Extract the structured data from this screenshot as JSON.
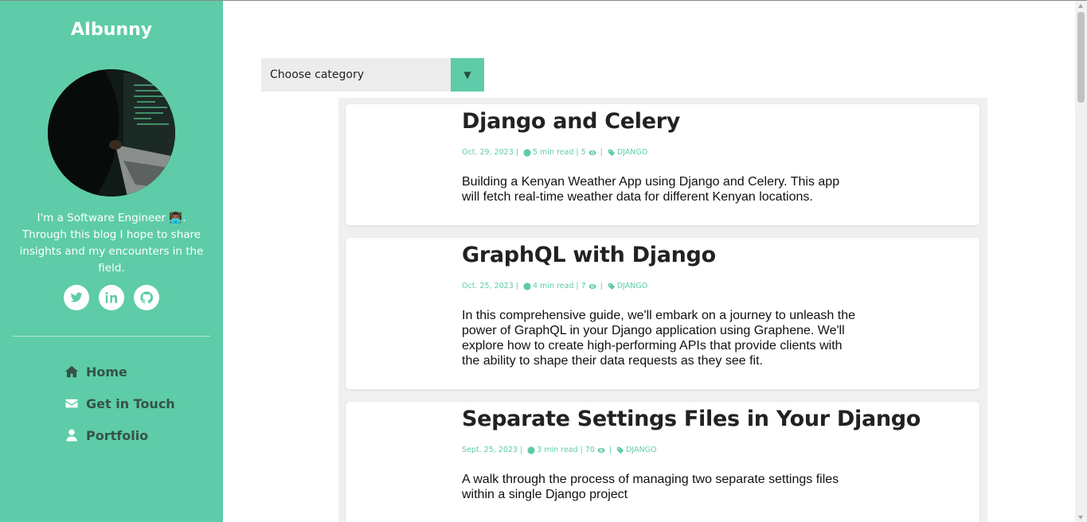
{
  "sidebar": {
    "brand": "AIbunny",
    "bio": "I'm a Software Engineer 👨🏾‍💻. Through this blog I hope to share insights and my encounters in the field.",
    "socials": [
      {
        "icon": "twitter-icon"
      },
      {
        "icon": "linkedin-icon"
      },
      {
        "icon": "github-icon"
      }
    ],
    "nav": [
      {
        "label": "Home",
        "icon": "home-icon"
      },
      {
        "label": "Get in Touch",
        "icon": "envelope-icon"
      },
      {
        "label": "Portfolio",
        "icon": "user-icon"
      }
    ]
  },
  "filter": {
    "selected": "Choose category",
    "arrow": "▼"
  },
  "posts": [
    {
      "title": "Django and Celery",
      "date": "Oct. 29, 2023",
      "read_time": "5 min read",
      "views": "5",
      "category": "DJANGO",
      "excerpt": " Building a Kenyan Weather App using Django and Celery. This app will fetch real-time weather data for different Kenyan locations."
    },
    {
      "title": "GraphQL with Django",
      "date": "Oct. 25, 2023",
      "read_time": "4 min read",
      "views": "7",
      "category": "DJANGO",
      "excerpt": "In this comprehensive guide, we'll embark on a journey to unleash the power of GraphQL in your Django application using Graphene. We'll explore how to create high-performing APIs that provide clients with the ability to shape their data requests as they see fit."
    },
    {
      "title": "Separate Settings Files in Your Django",
      "date": "Sept. 25, 2023",
      "read_time": "3 min read",
      "views": "70",
      "category": "DJANGO",
      "excerpt": "A walk through the process of managing two separate settings files within a single Django project"
    }
  ],
  "colors": {
    "accent": "#5ecca8",
    "nav_text": "#35524a"
  },
  "separator": "|"
}
